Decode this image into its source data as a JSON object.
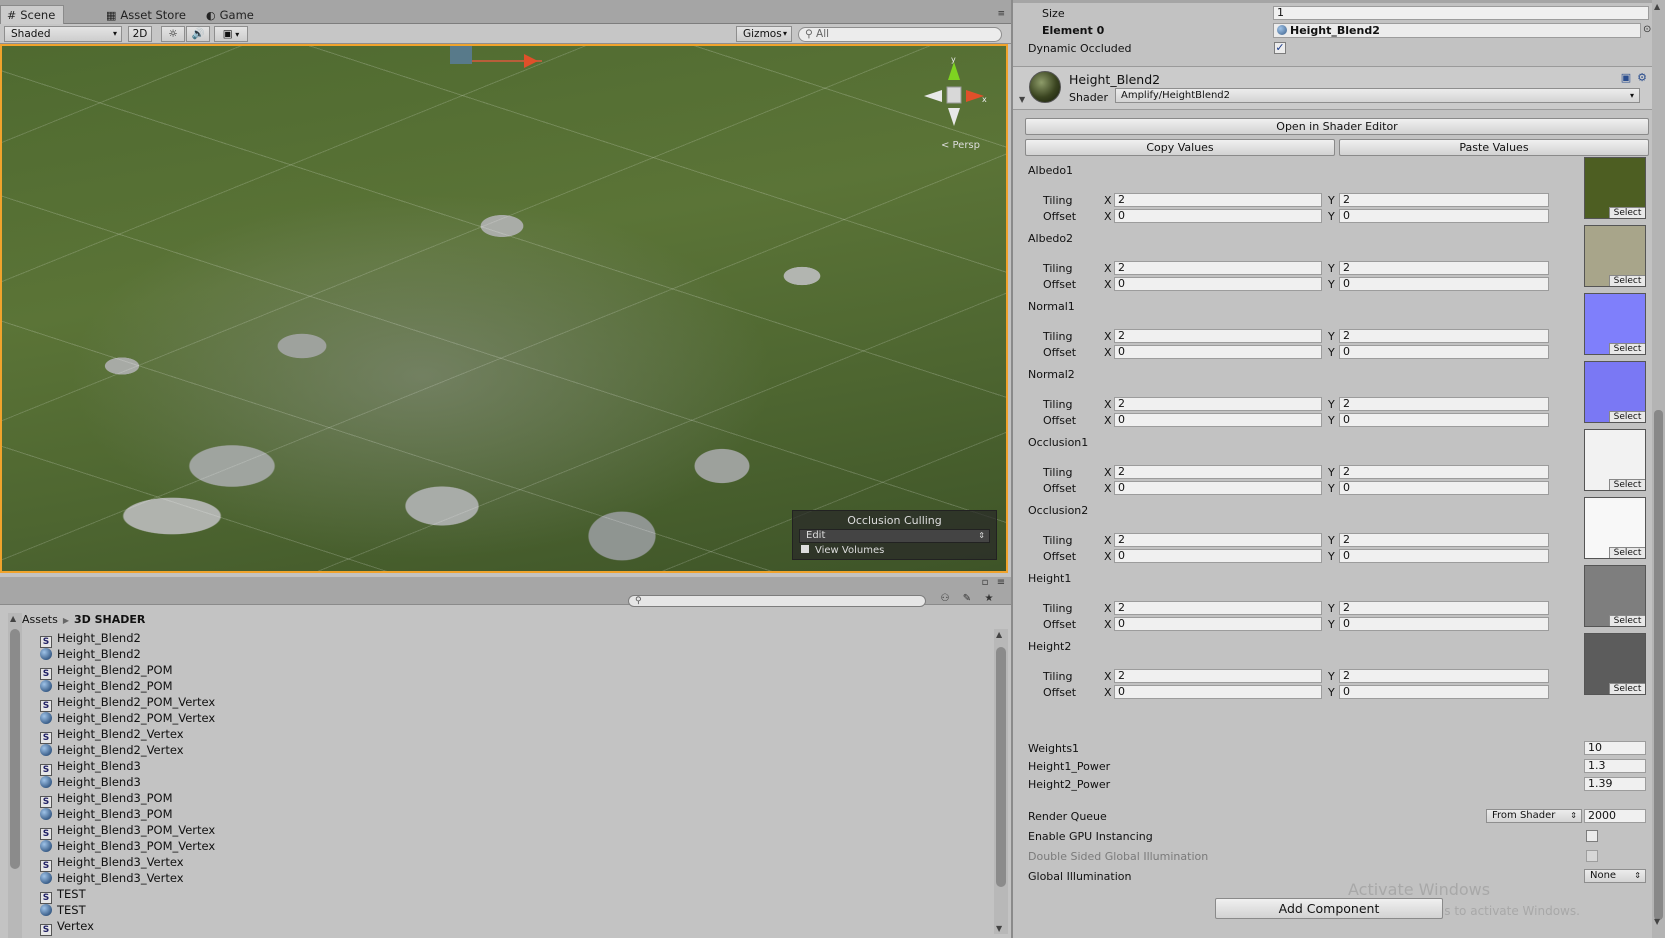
{
  "scene": {
    "tabs": [
      {
        "icon": "#",
        "label": "Scene"
      },
      {
        "icon": "▦",
        "label": "Asset Store"
      },
      {
        "icon": "◐",
        "label": "Game"
      }
    ],
    "toolbar": {
      "shading_mode": "Shaded",
      "btn_2d": "2D",
      "btn_light": "☼",
      "btn_audio": "🔊",
      "btn_fx": "▣",
      "gizmos": "Gizmos",
      "search_placeholder": "All"
    },
    "gizmo_persp": "< Persp",
    "occlusion": {
      "title": "Occlusion Culling",
      "mode": "Edit",
      "view_volumes": "View Volumes"
    }
  },
  "project": {
    "breadcrumb_root": "Assets",
    "breadcrumb_current": "3D SHADER",
    "items": [
      {
        "type": "shader",
        "name": "Height_Blend2"
      },
      {
        "type": "material",
        "name": "Height_Blend2"
      },
      {
        "type": "shader",
        "name": "Height_Blend2_POM"
      },
      {
        "type": "material",
        "name": "Height_Blend2_POM"
      },
      {
        "type": "shader",
        "name": "Height_Blend2_POM_Vertex"
      },
      {
        "type": "material",
        "name": "Height_Blend2_POM_Vertex"
      },
      {
        "type": "shader",
        "name": "Height_Blend2_Vertex"
      },
      {
        "type": "material",
        "name": "Height_Blend2_Vertex"
      },
      {
        "type": "shader",
        "name": "Height_Blend3"
      },
      {
        "type": "material",
        "name": "Height_Blend3"
      },
      {
        "type": "shader",
        "name": "Height_Blend3_POM"
      },
      {
        "type": "material",
        "name": "Height_Blend3_POM"
      },
      {
        "type": "shader",
        "name": "Height_Blend3_POM_Vertex"
      },
      {
        "type": "material",
        "name": "Height_Blend3_POM_Vertex"
      },
      {
        "type": "shader",
        "name": "Height_Blend3_Vertex"
      },
      {
        "type": "material",
        "name": "Height_Blend3_Vertex"
      },
      {
        "type": "shader",
        "name": "TEST"
      },
      {
        "type": "material",
        "name": "TEST"
      },
      {
        "type": "shader",
        "name": "Vertex"
      }
    ]
  },
  "inspector": {
    "size_label": "Size",
    "size_value": "1",
    "element0_label": "Element 0",
    "element0_value": "Height_Blend2",
    "dynamic_occluded_label": "Dynamic Occluded",
    "material_name": "Height_Blend2",
    "shader_label": "Shader",
    "shader_value": "Amplify/HeightBlend2",
    "open_shader_editor": "Open in Shader Editor",
    "copy_values": "Copy Values",
    "paste_values": "Paste Values",
    "tiling_label": "Tiling",
    "offset_label": "Offset",
    "x_label": "X",
    "y_label": "Y",
    "select_label": "Select",
    "textures": [
      {
        "name": "Albedo1",
        "tiling_x": "2",
        "tiling_y": "2",
        "offset_x": "0",
        "offset_y": "0",
        "color": "#4d5e22"
      },
      {
        "name": "Albedo2",
        "tiling_x": "2",
        "tiling_y": "2",
        "offset_x": "0",
        "offset_y": "0",
        "color": "#a8a58a"
      },
      {
        "name": "Normal1",
        "tiling_x": "2",
        "tiling_y": "2",
        "offset_x": "0",
        "offset_y": "0",
        "color": "#7f7ffb"
      },
      {
        "name": "Normal2",
        "tiling_x": "2",
        "tiling_y": "2",
        "offset_x": "0",
        "offset_y": "0",
        "color": "#7a78f4"
      },
      {
        "name": "Occlusion1",
        "tiling_x": "2",
        "tiling_y": "2",
        "offset_x": "0",
        "offset_y": "0",
        "color": "#f2f2f2"
      },
      {
        "name": "Occlusion2",
        "tiling_x": "2",
        "tiling_y": "2",
        "offset_x": "0",
        "offset_y": "0",
        "color": "#f8f8f8"
      },
      {
        "name": "Height1",
        "tiling_x": "2",
        "tiling_y": "2",
        "offset_x": "0",
        "offset_y": "0",
        "color": "#7e7e7e"
      },
      {
        "name": "Height2",
        "tiling_x": "2",
        "tiling_y": "2",
        "offset_x": "0",
        "offset_y": "0",
        "color": "#5c5c5c"
      }
    ],
    "weights1_label": "Weights1",
    "weights1_value": "10",
    "height1_power_label": "Height1_Power",
    "height1_power_value": "1.3",
    "height2_power_label": "Height2_Power",
    "height2_power_value": "1.39",
    "render_queue_label": "Render Queue",
    "render_queue_mode": "From Shader",
    "render_queue_value": "2000",
    "gpu_instancing_label": "Enable GPU Instancing",
    "double_sided_gi_label": "Double Sided Global Illumination",
    "global_illumination_label": "Global Illumination",
    "global_illumination_value": "None",
    "add_component": "Add Component",
    "watermark_title": "Activate Windows",
    "watermark_sub": "Go to Settings to activate Windows."
  },
  "colors": {
    "selection_outline": "#f0a32c",
    "checkbox_check": "#1a3a8a"
  }
}
